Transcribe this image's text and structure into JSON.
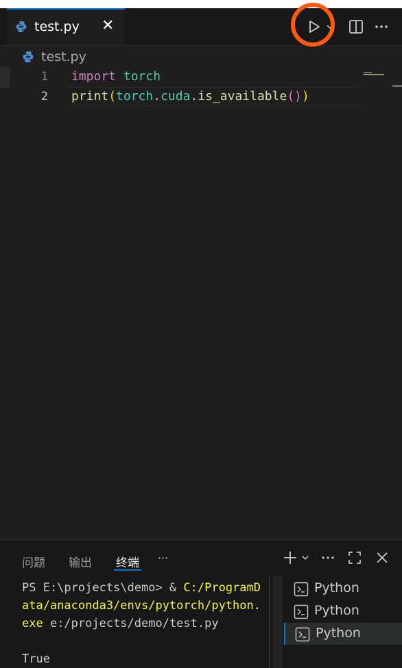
{
  "tab": {
    "filename": "test.py",
    "close_glyph": "✕"
  },
  "breadcrumb": {
    "filename": "test.py"
  },
  "editor": {
    "line_numbers": [
      "1",
      "2"
    ],
    "line1": {
      "kw": "import",
      "sp": " ",
      "mod": "torch"
    },
    "line2": {
      "fn": "print",
      "p1": "(",
      "m1": "torch",
      "d1": ".",
      "m2": "cuda",
      "d2": ".",
      "fn2": "is_available",
      "p2": "(",
      "p3": ")",
      "p4": ")"
    }
  },
  "panel": {
    "tabs": [
      "问题",
      "输出",
      "终端"
    ],
    "active_tab": "终端",
    "more_glyph": "···",
    "terminal": {
      "prompt": "PS E:\\projects\\demo> & ",
      "exe_path": "C:/ProgramData/anaconda3/envs/pytorch/python.exe",
      "arg": " e:/projects/demo/test.py",
      "output": "True"
    },
    "terminal_list": [
      "Python",
      "Python",
      "Python"
    ]
  },
  "icons": {
    "python": "python-icon",
    "run": "play-icon",
    "split": "split-editor-icon",
    "more": "more-icon",
    "terminal": "terminal-icon"
  },
  "colors": {
    "accent": "#0078d4",
    "highlight_circle": "#ff5a10"
  }
}
